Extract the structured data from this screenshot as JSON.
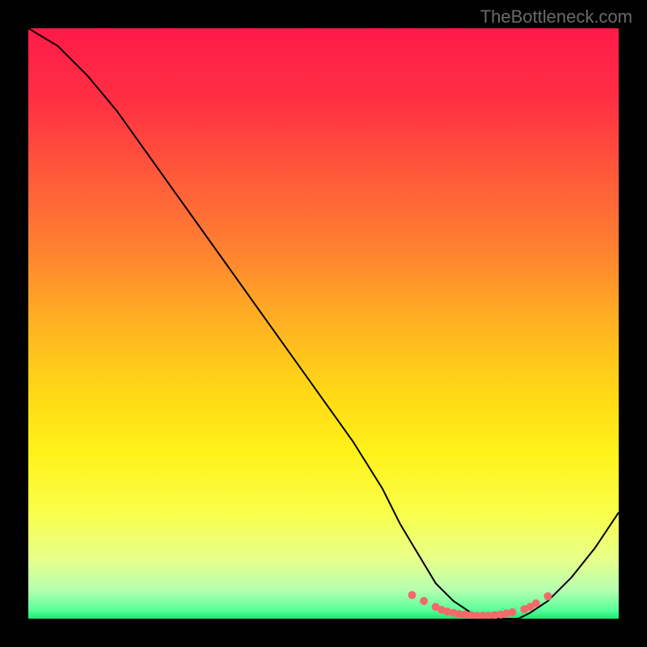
{
  "watermark": "TheBottleneck.com",
  "chart_data": {
    "type": "line",
    "title": "",
    "xlabel": "",
    "ylabel": "",
    "xlim": [
      0,
      100
    ],
    "ylim": [
      0,
      100
    ],
    "background": {
      "type": "vertical-gradient",
      "stops": [
        {
          "pos": 0.0,
          "color": "#ff1a49"
        },
        {
          "pos": 0.12,
          "color": "#ff2f43"
        },
        {
          "pos": 0.25,
          "color": "#ff5a3a"
        },
        {
          "pos": 0.38,
          "color": "#ff8330"
        },
        {
          "pos": 0.5,
          "color": "#ffb222"
        },
        {
          "pos": 0.62,
          "color": "#ffd916"
        },
        {
          "pos": 0.72,
          "color": "#fff21a"
        },
        {
          "pos": 0.82,
          "color": "#faff4a"
        },
        {
          "pos": 0.9,
          "color": "#e6ff8a"
        },
        {
          "pos": 0.95,
          "color": "#b8ffb0"
        },
        {
          "pos": 0.985,
          "color": "#5cff9c"
        },
        {
          "pos": 1.0,
          "color": "#17e86f"
        }
      ]
    },
    "series": [
      {
        "name": "bottleneck-curve",
        "color": "#000000",
        "width": 2,
        "x": [
          0,
          5,
          10,
          15,
          20,
          25,
          30,
          35,
          40,
          45,
          50,
          55,
          60,
          63,
          66,
          69,
          72,
          75,
          78,
          81,
          83,
          85,
          88,
          92,
          96,
          100
        ],
        "y": [
          100,
          97,
          92,
          86,
          79,
          72,
          65,
          58,
          51,
          44,
          37,
          30,
          22,
          16,
          11,
          6,
          3,
          1,
          0,
          0,
          0,
          1,
          3,
          7,
          12,
          18
        ]
      }
    ],
    "markers": {
      "name": "flat-region-dots",
      "color": "#f36a6a",
      "radius": 5,
      "x": [
        65,
        67,
        69,
        70,
        71,
        72,
        73,
        74,
        75,
        76,
        77,
        78,
        79,
        80,
        81,
        82,
        84,
        85,
        86,
        88
      ],
      "y": [
        4,
        3,
        2,
        1.5,
        1.2,
        1.0,
        0.8,
        0.7,
        0.6,
        0.5,
        0.5,
        0.5,
        0.6,
        0.7,
        0.9,
        1.1,
        1.6,
        2.0,
        2.6,
        3.8
      ]
    }
  }
}
